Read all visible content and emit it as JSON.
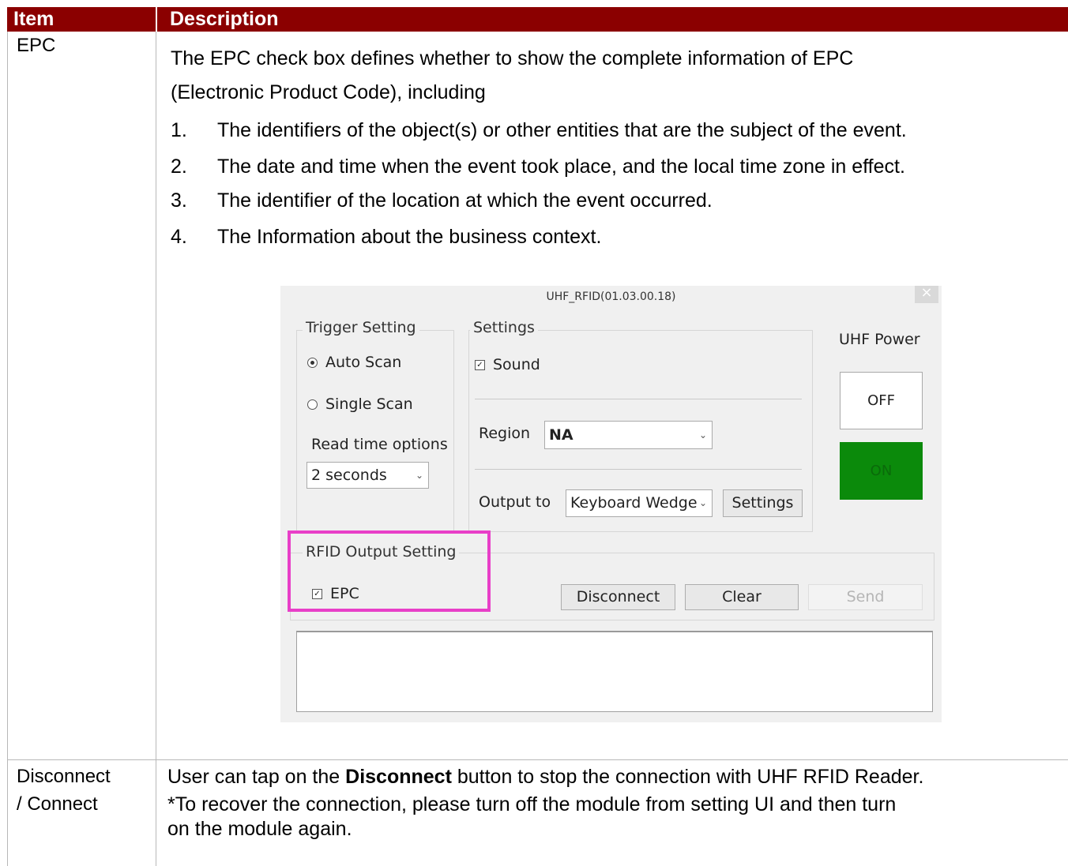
{
  "table": {
    "headers": {
      "item": "Item",
      "description": "Description"
    },
    "rows": [
      {
        "item": "EPC",
        "description_lines": [
          "The EPC check box defines whether to show the complete information of EPC",
          "(Electronic Product Code), including"
        ],
        "list": [
          {
            "num": "1.",
            "text": "The identifiers of the object(s) or other entities that are the subject of the event."
          },
          {
            "num": "2.",
            "text": "The date and time when the event took place, and the local time zone in effect."
          },
          {
            "num": "3.",
            "text": "The identifier of the location at which the event occurred."
          },
          {
            "num": "4.",
            "text": "The Information about the business context."
          }
        ]
      },
      {
        "item_lines": [
          "Disconnect",
          "/ Connect"
        ],
        "desc_prefix": "User can tap on the ",
        "desc_bold": "Disconnect",
        "desc_suffix": " button to stop the connection with UHF RFID Reader.",
        "desc_line2": "*To recover the connection, please turn off the module from setting UI and then turn",
        "desc_line3": "on the module again."
      }
    ]
  },
  "app": {
    "title": "UHF_RFID(01.03.00.18)",
    "close_icon": "×",
    "trigger": {
      "label": "Trigger Setting",
      "auto_scan": "Auto Scan",
      "single_scan": "Single Scan",
      "read_time_label": "Read time options",
      "read_time_value": "2 seconds"
    },
    "settings": {
      "label": "Settings",
      "sound": "Sound",
      "region_label": "Region",
      "region_value": "NA",
      "output_label": "Output to",
      "output_value": "Keyboard Wedge",
      "settings_button": "Settings"
    },
    "power": {
      "label": "UHF Power",
      "off": "OFF",
      "on": "ON",
      "on_color": "#0b8a0b"
    },
    "rfid_output": {
      "label": "RFID Output Setting",
      "epc": "EPC"
    },
    "buttons": {
      "disconnect": "Disconnect",
      "clear": "Clear",
      "send": "Send"
    },
    "highlight_color": "#e83fc8"
  },
  "colors": {
    "header_bg": "#8b0000",
    "header_text": "#ffffff",
    "grid": "#b8b8b8"
  }
}
